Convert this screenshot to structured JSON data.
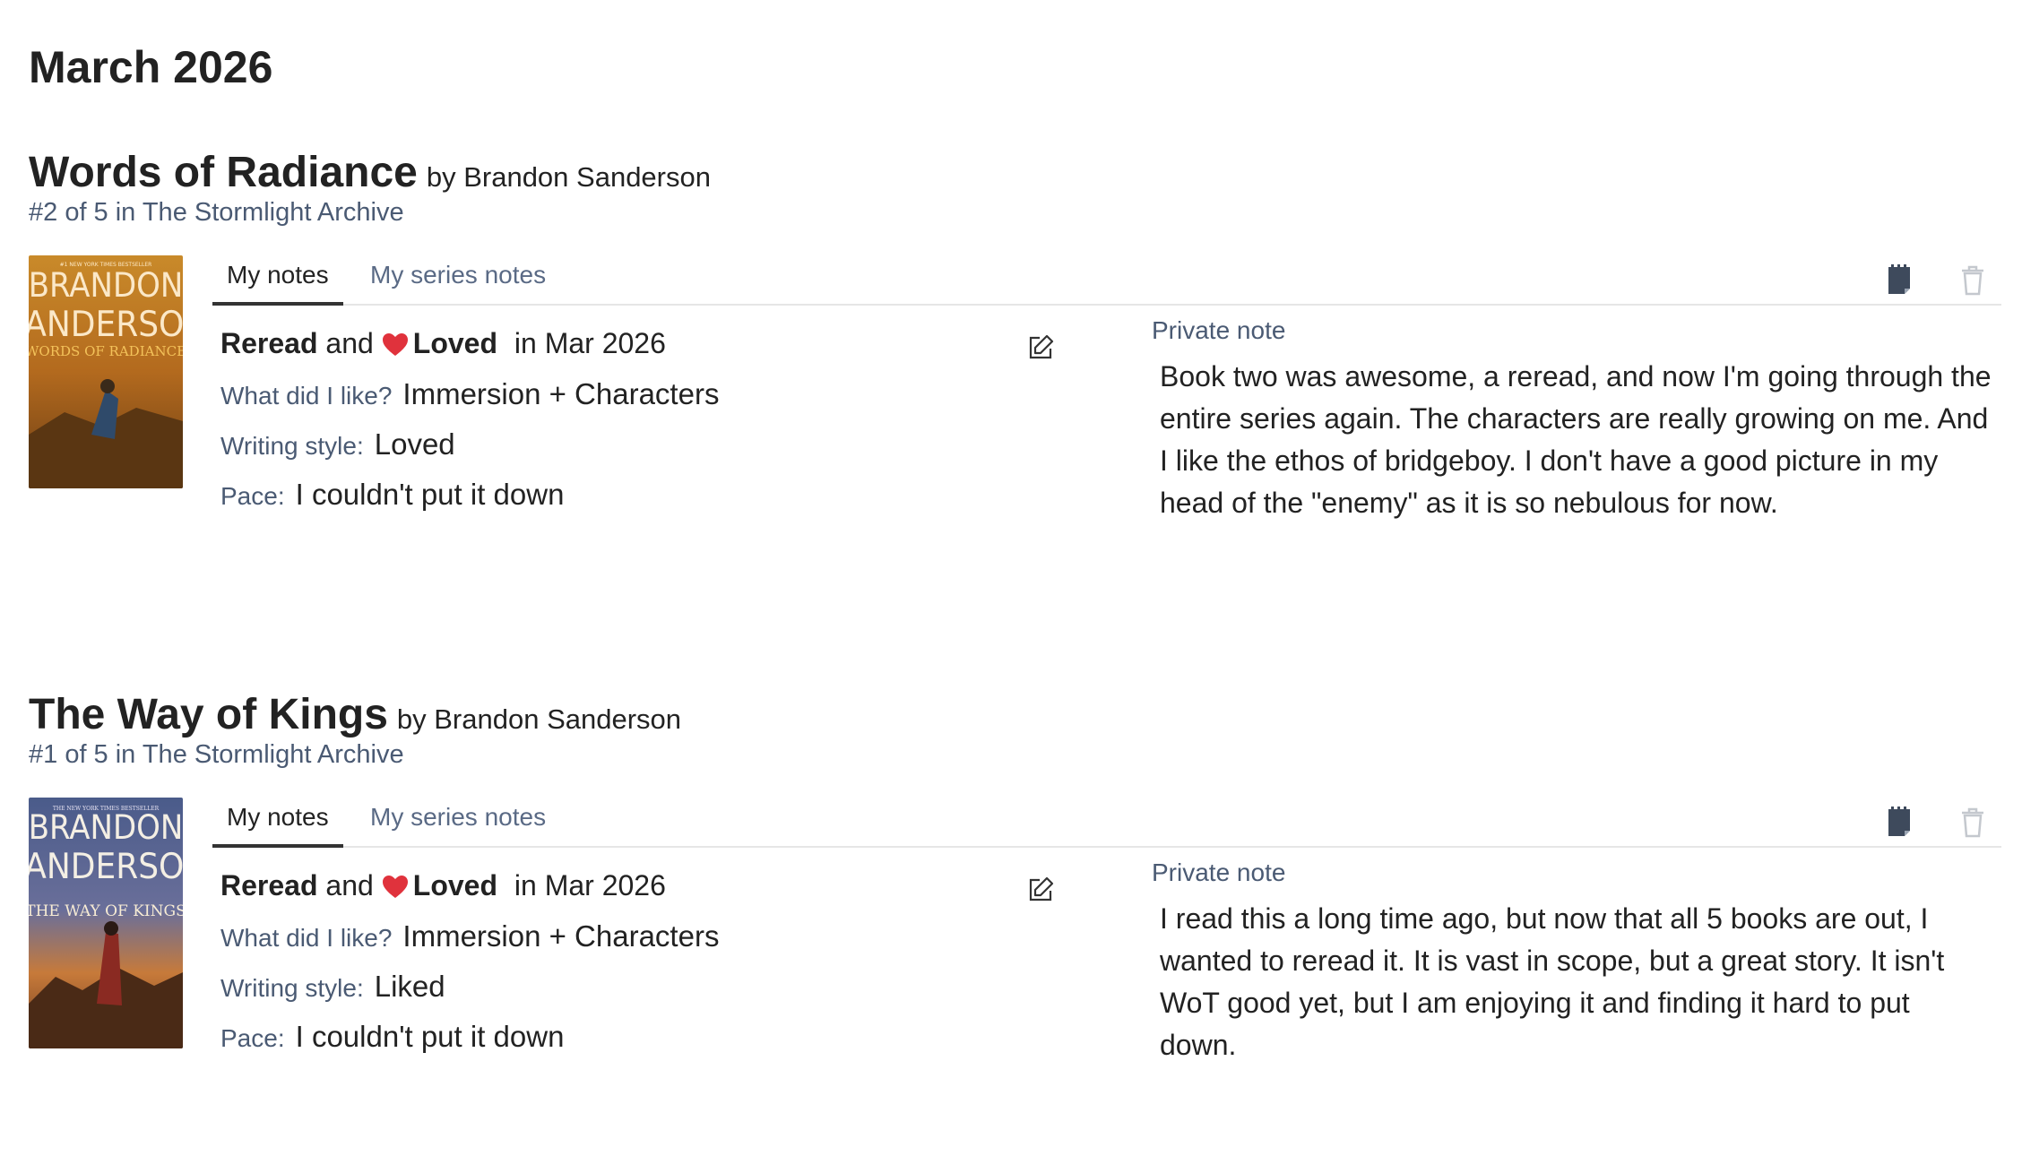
{
  "page": {
    "month_heading": "March 2026"
  },
  "colors": {
    "heart": "#e0323c",
    "link": "#4a5a73",
    "text": "#222222"
  },
  "tabs": {
    "my_notes": "My notes",
    "series_notes": "My series notes"
  },
  "labels": {
    "reread": "Reread",
    "and": "and",
    "loved": "Loved",
    "in_prefix": "in",
    "what_did_i_like": "What did I like?",
    "writing_style": "Writing style:",
    "pace": "Pace:",
    "private_note": "Private note"
  },
  "books": [
    {
      "title": "Words of Radiance",
      "author": "by Brandon Sanderson",
      "series": "#2 of 5 in The Stormlight Archive",
      "cover": {
        "author_line1": "BRANDON",
        "author_line2": "SANDERSON",
        "title_text": "WORDS OF RADIANCE",
        "top_text": "#1 NEW YORK TIMES BESTSELLER"
      },
      "read_date": "Mar 2026",
      "liked": "Immersion + Characters",
      "writing_style": "Loved",
      "pace": "I couldn't put it down",
      "note": "Book two was awesome, a reread, and now I'm going through the entire series again. The characters are really growing on me. And I like the ethos of bridgeboy. I don't have a good picture in my head of the \"enemy\" as it is so nebulous for now."
    },
    {
      "title": "The Way of Kings",
      "author": "by Brandon Sanderson",
      "series": "#1 of 5 in The Stormlight Archive",
      "cover": {
        "author_line1": "BRANDON",
        "author_line2": "SANDERSON",
        "title_text": "THE WAY OF KINGS",
        "top_text": "THE NEW YORK TIMES BESTSELLER"
      },
      "read_date": "Mar 2026",
      "liked": "Immersion + Characters",
      "writing_style": "Liked",
      "pace": "I couldn't put it down",
      "note": "I read this a long time ago, but now that all 5 books are out, I wanted to reread it.  It is vast in scope, but a great story. It isn't WoT good yet, but I am enjoying it and finding it hard to put down."
    }
  ],
  "icons": {
    "shelf": "bookmark-shelf-icon",
    "trash": "trash-icon",
    "edit": "edit-pencil-icon",
    "heart": "heart-icon"
  }
}
